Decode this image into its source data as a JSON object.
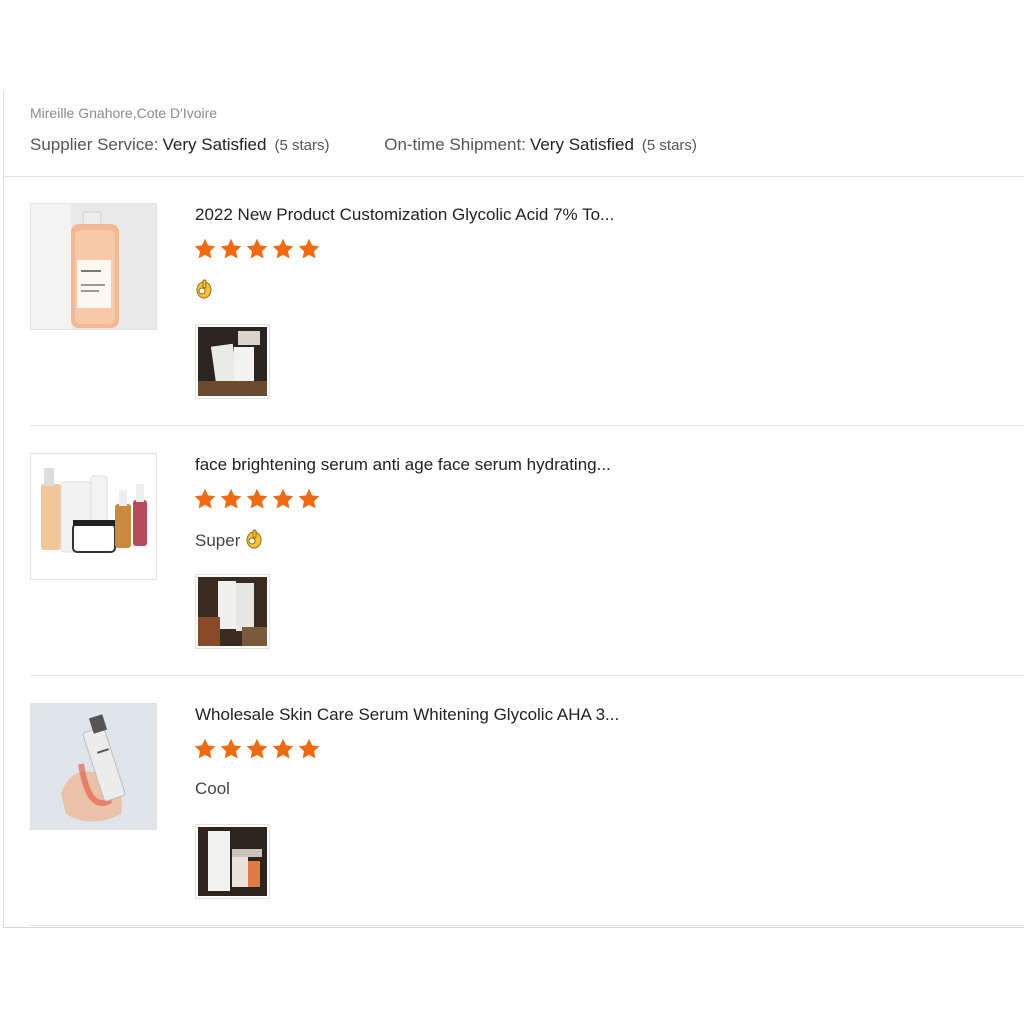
{
  "reviewer": {
    "name_location": "Mireille Gnahore,Cote D'Ivoire"
  },
  "ratings": {
    "supplier_service": {
      "label": "Supplier Service:",
      "value": "Very Satisfied",
      "stars_text": "(5 stars)"
    },
    "ontime_shipment": {
      "label": "On-time Shipment:",
      "value": "Very Satisfied",
      "stars_text": "(5 stars)"
    }
  },
  "reviews": [
    {
      "title": "2022 New Product Customization Glycolic Acid 7% To...",
      "rating": 5,
      "comment": "",
      "has_ok_emoji": true
    },
    {
      "title": "face brightening serum anti age face serum hydrating...",
      "rating": 5,
      "comment": "Super",
      "has_ok_emoji": true
    },
    {
      "title": "Wholesale Skin Care Serum Whitening Glycolic AHA 3...",
      "rating": 5,
      "comment": "Cool",
      "has_ok_emoji": false
    }
  ],
  "colors": {
    "star": "#f26a10",
    "divider": "#e2e2e2"
  },
  "icons": {
    "star": "star-icon",
    "ok_hand": "ok-hand-emoji-icon"
  }
}
